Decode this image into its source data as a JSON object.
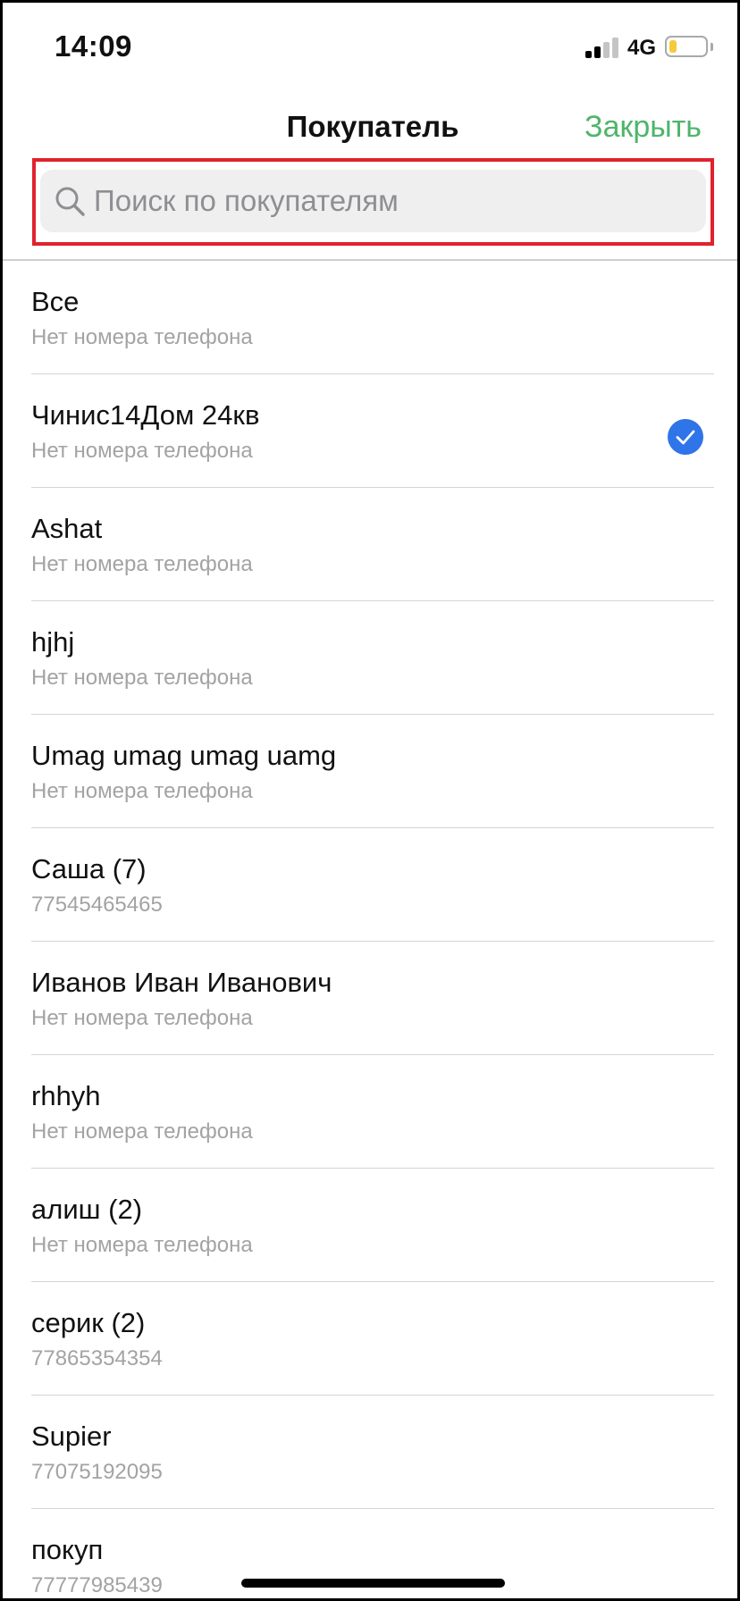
{
  "status_bar": {
    "time": "14:09",
    "network": "4G",
    "signal_bars_active": 2,
    "signal_bars_total": 4,
    "battery_level": 0.2
  },
  "header": {
    "title": "Покупатель",
    "close_label": "Закрыть"
  },
  "search": {
    "placeholder": "Поиск по покупателям",
    "value": ""
  },
  "colors": {
    "accent_green": "#4fb56b",
    "check_blue": "#2f74e8",
    "highlight_red": "#e0222e",
    "battery_yellow": "#f5cb3b"
  },
  "customers": [
    {
      "name": "Все",
      "phone": "Нет номера телефона",
      "selected": false
    },
    {
      "name": "Чинис14Дом 24кв",
      "phone": "Нет номера телефона",
      "selected": true
    },
    {
      "name": "Ashat",
      "phone": "Нет номера телефона",
      "selected": false
    },
    {
      "name": "hjhj",
      "phone": "Нет номера телефона",
      "selected": false
    },
    {
      "name": "Umag umag umag uamg",
      "phone": "Нет номера телефона",
      "selected": false
    },
    {
      "name": "Саша (7)",
      "phone": "77545465465",
      "selected": false
    },
    {
      "name": "Иванов Иван Иванович",
      "phone": "Нет номера телефона",
      "selected": false
    },
    {
      "name": "rhhyh",
      "phone": "Нет номера телефона",
      "selected": false
    },
    {
      "name": "алиш (2)",
      "phone": "Нет номера телефона",
      "selected": false
    },
    {
      "name": "серик (2)",
      "phone": "77865354354",
      "selected": false
    },
    {
      "name": "Supier",
      "phone": "77075192095",
      "selected": false
    },
    {
      "name": "покуп",
      "phone": "77777985439",
      "selected": false
    }
  ]
}
